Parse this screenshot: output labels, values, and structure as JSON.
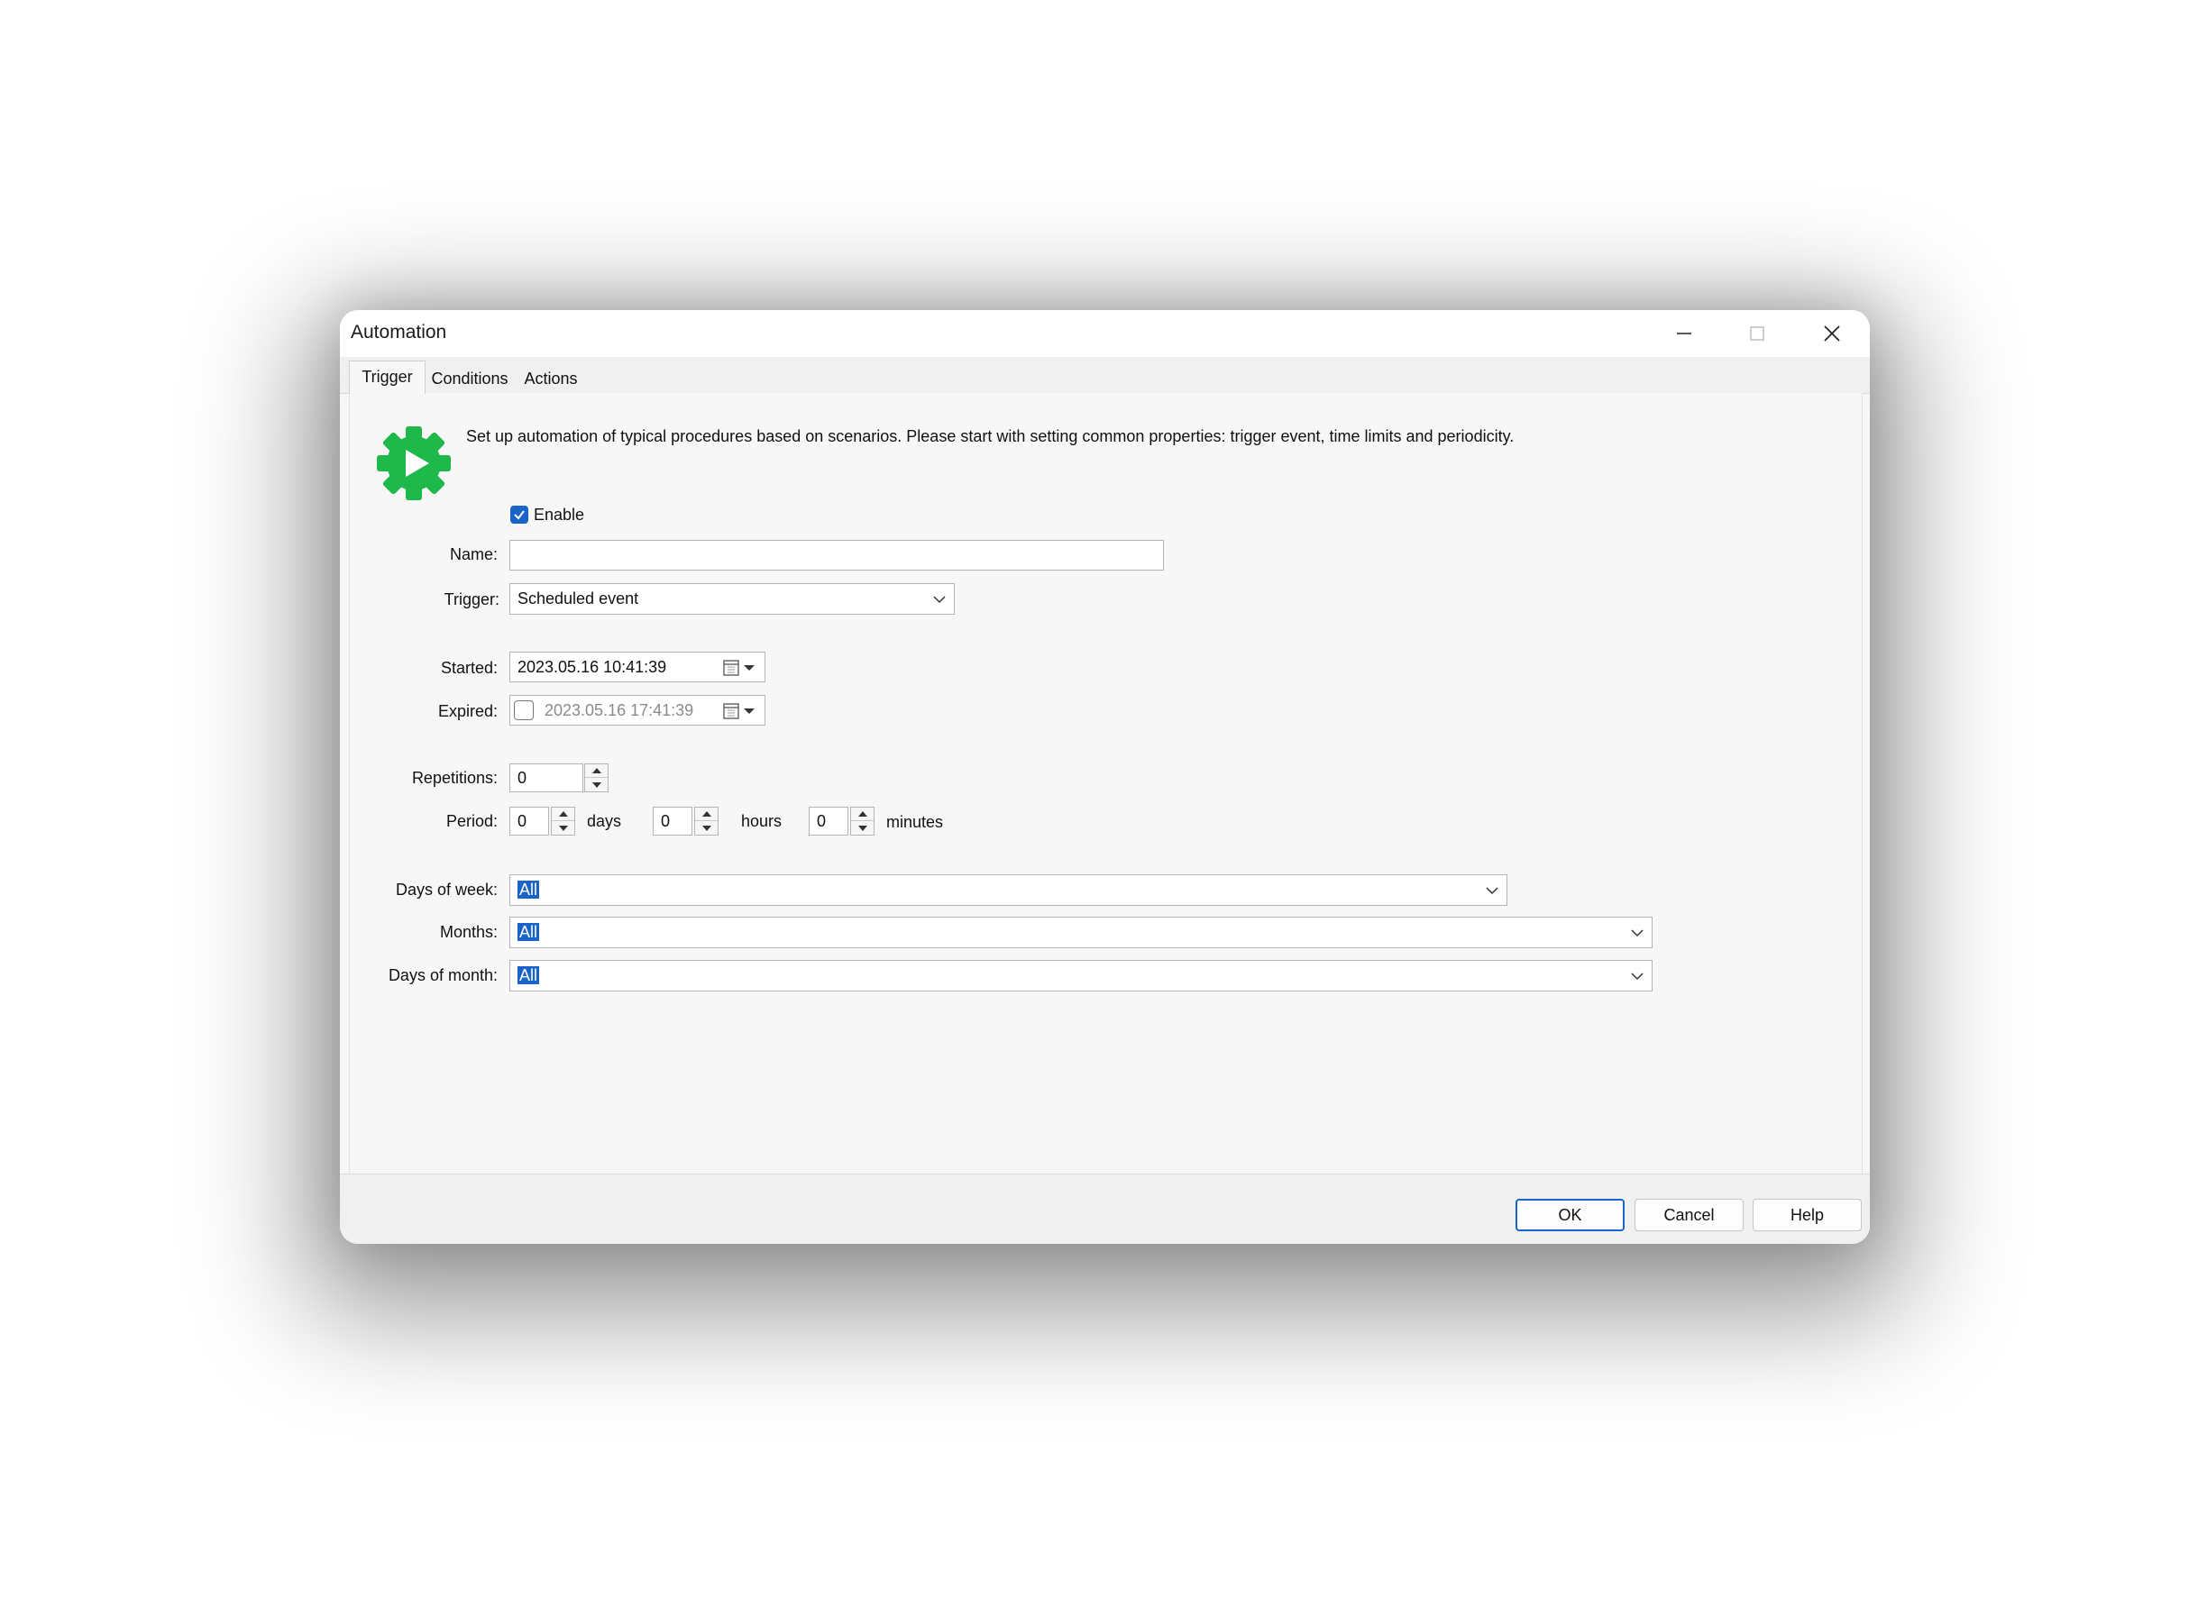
{
  "window": {
    "title": "Automation"
  },
  "tabs": [
    {
      "label": "Trigger",
      "active": true
    },
    {
      "label": "Conditions",
      "active": false
    },
    {
      "label": "Actions",
      "active": false
    }
  ],
  "trigger_tab": {
    "icon": "gear-play-icon",
    "icon_color": "#1fb84a",
    "description": "Set up automation of typical procedures based on scenarios. Please start with setting common properties: trigger event, time limits and periodicity.",
    "enable": {
      "label": "Enable",
      "checked": true
    },
    "name": {
      "label": "Name:",
      "value": ""
    },
    "trigger": {
      "label": "Trigger:",
      "value": "Scheduled event"
    },
    "started": {
      "label": "Started:",
      "value": "2023.05.16 10:41:39"
    },
    "expired": {
      "label": "Expired:",
      "value": "2023.05.16 17:41:39",
      "checked": false
    },
    "repetitions": {
      "label": "Repetitions:",
      "value": "0"
    },
    "period": {
      "label": "Period:",
      "days": {
        "value": "0",
        "unit": "days"
      },
      "hours": {
        "value": "0",
        "unit": "hours"
      },
      "minutes": {
        "value": "0",
        "unit": "minutes"
      }
    },
    "days_of_week": {
      "label": "Days of week:",
      "value": "All"
    },
    "months": {
      "label": "Months:",
      "value": "All"
    },
    "days_of_month": {
      "label": "Days of month:",
      "value": "All"
    }
  },
  "buttons": {
    "ok": "OK",
    "cancel": "Cancel",
    "help": "Help"
  },
  "colors": {
    "accent": "#1a63c9",
    "icon_green": "#1fb84a"
  }
}
